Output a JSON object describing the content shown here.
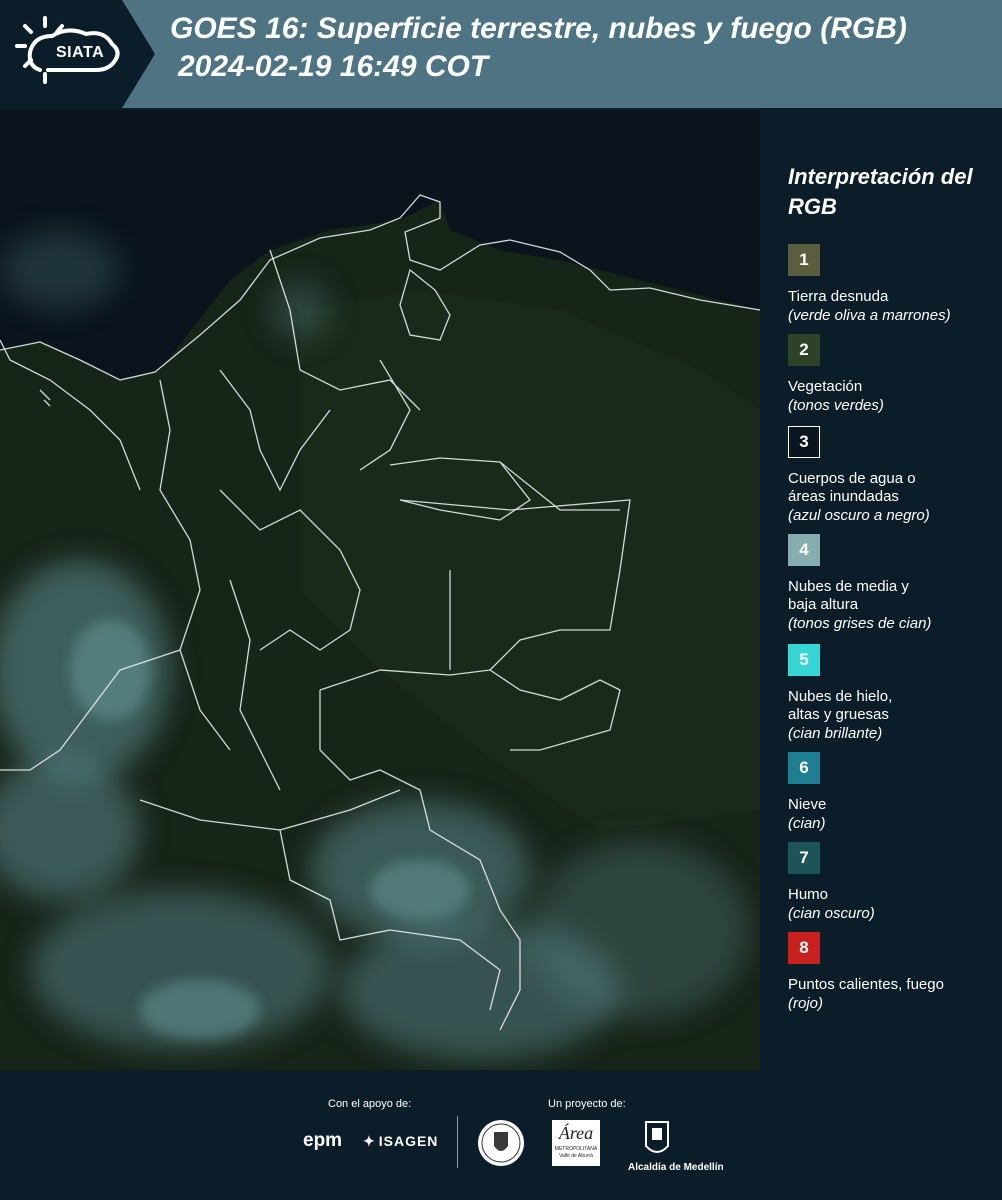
{
  "header": {
    "logo_text": "SIATA",
    "title_line1": "GOES 16: Superficie terrestre, nubes y fuego (RGB)",
    "title_line2": "2024-02-19 16:49 COT"
  },
  "legend": {
    "title": "Interpretación del RGB",
    "items": [
      {
        "number": "1",
        "label": "Tierra desnuda",
        "description": "(verde oliva a marrones)",
        "color": "#5b5d3e"
      },
      {
        "number": "2",
        "label": "Vegetación",
        "description": "(tonos verdes)",
        "color": "#2d4226"
      },
      {
        "number": "3",
        "label": "Cuerpos de agua o áreas inundadas",
        "description": "(azul oscuro a negro)",
        "color": "#0b1520"
      },
      {
        "number": "4",
        "label": "Nubes de media y baja altura",
        "description": "(tonos grises de cian)",
        "color": "#86aeaf"
      },
      {
        "number": "5",
        "label": "Nubes de hielo, altas y gruesas",
        "description": "(cian brillante)",
        "color": "#37d6d6"
      },
      {
        "number": "6",
        "label": "Nieve",
        "description": "(cian)",
        "color": "#1e7f92"
      },
      {
        "number": "7",
        "label": "Humo",
        "description": "(cian oscuro)",
        "color": "#1c5457"
      },
      {
        "number": "8",
        "label": "Puntos calientes, fuego",
        "description": "(rojo)",
        "color": "#c8201e"
      }
    ]
  },
  "footer": {
    "support_label": "Con el apoyo de:",
    "project_label": "Un proyecto de:",
    "epm": "epm",
    "isagen": "ISAGEN",
    "area_name": "Área",
    "area_sub": "METROPOLITANA Valle de Aburrá",
    "alcaldia": "Alcaldía de Medellín"
  }
}
